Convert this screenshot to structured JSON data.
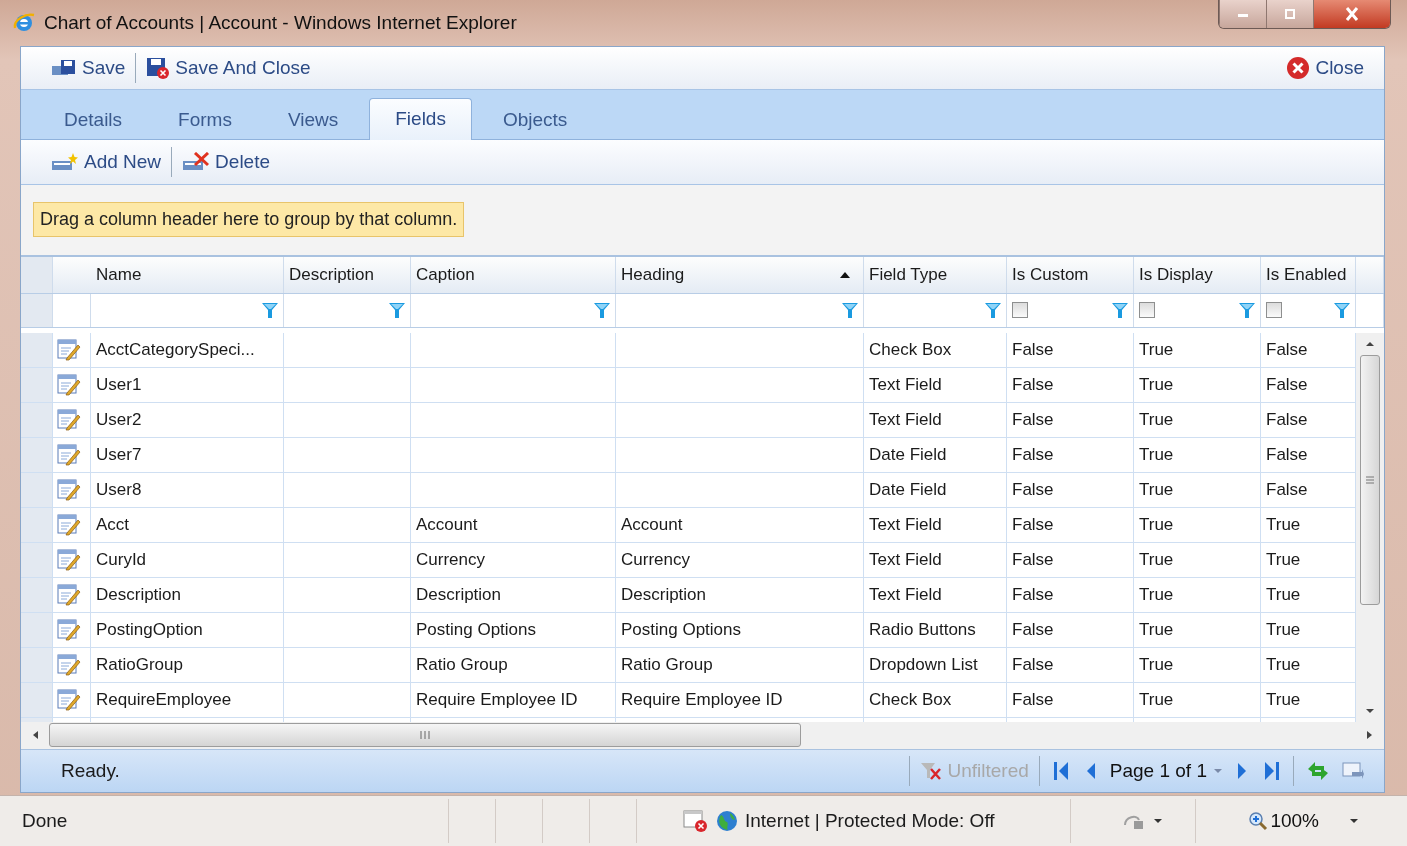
{
  "window": {
    "title": "Chart of Accounts | Account - Windows Internet Explorer"
  },
  "toolbar": {
    "left": [
      {
        "label": "Save",
        "kind": "save"
      },
      {
        "label": "Save And Close",
        "kind": "saveclose"
      }
    ],
    "right": [
      {
        "label": "Close",
        "kind": "close"
      }
    ]
  },
  "tabs": [
    {
      "label": "Details",
      "selected": false
    },
    {
      "label": "Forms",
      "selected": false
    },
    {
      "label": "Views",
      "selected": false
    },
    {
      "label": "Fields",
      "selected": true
    },
    {
      "label": "Objects",
      "selected": false
    }
  ],
  "grid_toolbar": [
    {
      "label": "Add New",
      "kind": "add"
    },
    {
      "label": "Delete",
      "kind": "delete"
    }
  ],
  "group_panel": "Drag a column header here to group by that column.",
  "table": {
    "columns": [
      {
        "label": "Name",
        "sorted": false,
        "kind": "text"
      },
      {
        "label": "Description",
        "sorted": false,
        "kind": "text"
      },
      {
        "label": "Caption",
        "sorted": false,
        "kind": "text"
      },
      {
        "label": "Heading",
        "sorted": true,
        "kind": "text"
      },
      {
        "label": "Field Type",
        "sorted": false,
        "kind": "text"
      },
      {
        "label": "Is Custom",
        "sorted": false,
        "kind": "check",
        "checked": false
      },
      {
        "label": "Is Display",
        "sorted": false,
        "kind": "check",
        "checked": false
      },
      {
        "label": "Is Enabled",
        "sorted": false,
        "kind": "check",
        "checked": false
      }
    ],
    "rows": [
      [
        "AcctCategorySpeci...",
        "",
        "",
        "",
        "Check Box",
        "False",
        "True",
        "False"
      ],
      [
        "User1",
        "",
        "",
        "",
        "Text Field",
        "False",
        "True",
        "False"
      ],
      [
        "User2",
        "",
        "",
        "",
        "Text Field",
        "False",
        "True",
        "False"
      ],
      [
        "User7",
        "",
        "",
        "",
        "Date Field",
        "False",
        "True",
        "False"
      ],
      [
        "User8",
        "",
        "",
        "",
        "Date Field",
        "False",
        "True",
        "False"
      ],
      [
        "Acct",
        "",
        "Account",
        "Account",
        "Text Field",
        "False",
        "True",
        "True"
      ],
      [
        "CuryId",
        "",
        "Currency",
        "Currency",
        "Text Field",
        "False",
        "True",
        "True"
      ],
      [
        "Description",
        "",
        "Description",
        "Description",
        "Text Field",
        "False",
        "True",
        "True"
      ],
      [
        "PostingOption",
        "",
        "Posting Options",
        "Posting Options",
        "Radio Buttons",
        "False",
        "True",
        "True"
      ],
      [
        "RatioGroup",
        "",
        "Ratio Group",
        "Ratio Group",
        "Dropdown List",
        "False",
        "True",
        "True"
      ],
      [
        "RequireEmployee",
        "",
        "Require Employee ID",
        "Require Employee ID",
        "Check Box",
        "False",
        "True",
        "True"
      ]
    ]
  },
  "status": {
    "text": "Ready.",
    "filter_state": "Unfiltered",
    "page": "Page 1 of 1"
  },
  "browser_status": {
    "text": "Done",
    "zone": "Internet | Protected Mode: Off",
    "zoom": "100%"
  }
}
